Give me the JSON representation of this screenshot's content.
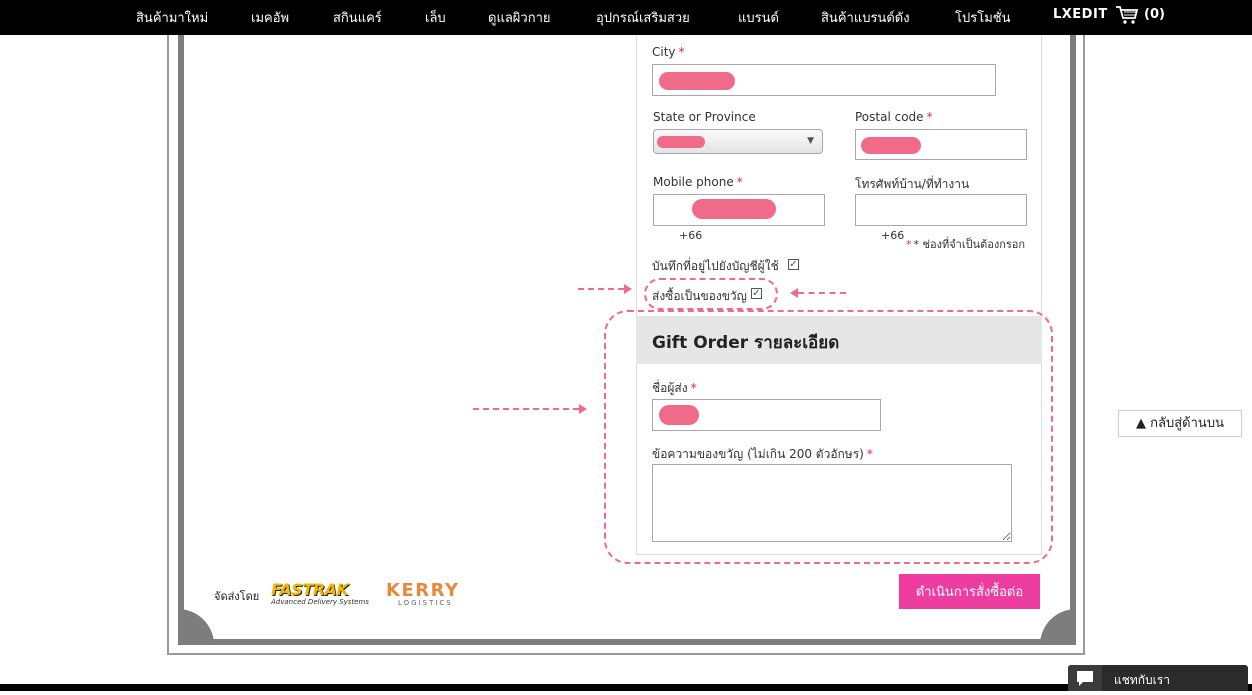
{
  "nav": {
    "items": [
      "สินค้ามาใหม่",
      "เมคอัพ",
      "สกินแคร์",
      "เล็บ",
      "ดูแลผิวกาย",
      "อุปกรณ์เสริมสวย",
      "แบรนด์",
      "สินค้าแบรนด์ดัง",
      "โปรโมชั่น"
    ],
    "brand": "LXEDIT",
    "cart_count": "(0)"
  },
  "form": {
    "city_label": "City",
    "state_label": "State or Province",
    "postal_label": "Postal code",
    "mobile_label": "Mobile phone",
    "home_phone_label": "โทรศัพท์บ้าน/ที่ทำงาน",
    "mobile_prefix": "+66",
    "home_prefix": "+66",
    "required_note": "* ช่องที่จำเป็นต้องกรอก",
    "save_address_label": "บันทึกที่อยู่ไปยังบัญชีผู้ใช้",
    "gift_order_label": "ส่งซื้อเป็นของขวัญ",
    "required_mark": "*"
  },
  "gift": {
    "title": "Gift Order รายละเอียด",
    "sender_label": "ชื่อผู้ส่ง",
    "message_label": "ข้อความของขวัญ (ไม่เกิน 200 ตัวอักษร)"
  },
  "footer": {
    "ship_by": "จัดส่งโดย",
    "fastrak_name": "FASTRAK",
    "fastrak_tagline": "Advanced Delivery Systems",
    "kerry_name": "KERRY",
    "kerry_tagline": "LOGISTICS",
    "proceed_label": "ดำเนินการสั่งซื้อต่อ"
  },
  "back_to_top": "▲ กลับสู่ด้านบน",
  "chat_label": "แชทกับเรา",
  "colors": {
    "accent": "#ee3da0",
    "annotation": "#f06b8a",
    "nav_bg": "#000000"
  }
}
